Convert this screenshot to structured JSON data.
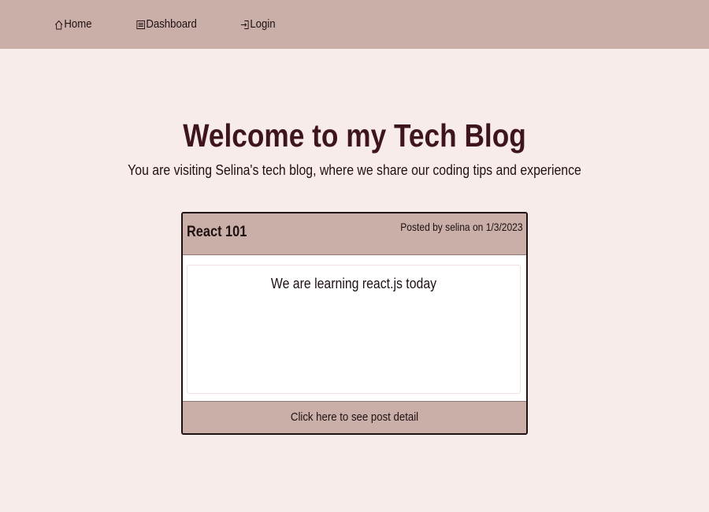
{
  "nav": {
    "items": [
      {
        "label": "Home",
        "icon": "home-icon"
      },
      {
        "label": "Dashboard",
        "icon": "list-icon"
      },
      {
        "label": "Login",
        "icon": "login-icon"
      }
    ]
  },
  "hero": {
    "title": "Welcome to my Tech Blog",
    "subtitle": "You are visiting Selina's tech blog, where we share our coding tips and experience"
  },
  "posts": [
    {
      "title": "React 101",
      "meta": "Posted by selina on 1/3/2023",
      "content": "We are learning react.js today",
      "detail_link": "Click here to see post detail"
    }
  ],
  "colors": {
    "background": "#f8ecea",
    "navbar": "#c9afa8",
    "title": "#3e141d",
    "text": "#1f1012"
  }
}
